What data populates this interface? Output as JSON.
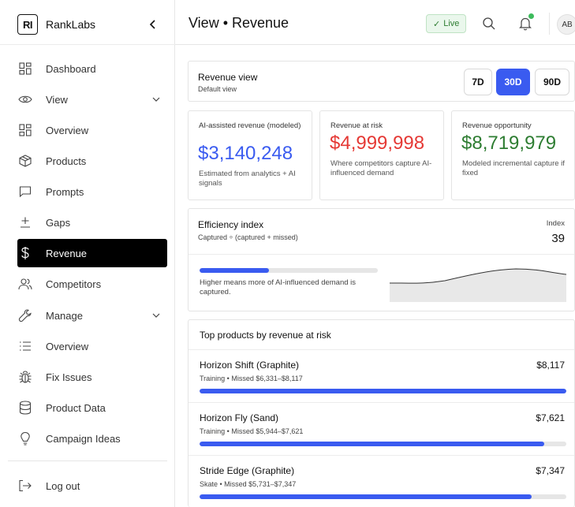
{
  "brand": {
    "mark": "RI",
    "name": "RankLabs"
  },
  "sidebar": {
    "top": [
      {
        "label": "Dashboard",
        "icon": "grid-icon"
      },
      {
        "label": "View",
        "icon": "eye-icon"
      }
    ],
    "view_items": [
      {
        "label": "Overview",
        "icon": "grid-icon"
      },
      {
        "label": "Products",
        "icon": "box-icon"
      },
      {
        "label": "Prompts",
        "icon": "message-icon"
      },
      {
        "label": "Gaps",
        "icon": "plus-minus-icon"
      },
      {
        "label": "Revenue",
        "icon": "dollar-icon"
      },
      {
        "label": "Competitors",
        "icon": "users-icon"
      }
    ],
    "manage": {
      "label": "Manage",
      "icon": "wrench-icon"
    },
    "manage_items": [
      {
        "label": "Overview",
        "icon": "list-icon"
      },
      {
        "label": "Fix Issues",
        "icon": "bug-icon"
      },
      {
        "label": "Product Data",
        "icon": "database-icon"
      },
      {
        "label": "Campaign Ideas",
        "icon": "lightbulb-icon"
      }
    ],
    "logout": {
      "label": "Log out",
      "icon": "logout-icon"
    },
    "active": "Revenue"
  },
  "header": {
    "title": "View • Revenue",
    "live_label": "Live",
    "avatar": "AB"
  },
  "revenue_view": {
    "title": "Revenue view",
    "subtitle": "Default view",
    "ranges": [
      "7D",
      "30D",
      "90D"
    ],
    "selected": "30D"
  },
  "metrics": [
    {
      "label": "AI-assisted revenue (modeled)",
      "value": "$3,140,248",
      "note": "Estimated from analytics + AI signals",
      "color": "#3a5bf0"
    },
    {
      "label": "Revenue at risk",
      "value": "$4,999,998",
      "note": "Where competitors capture AI-influenced demand",
      "color": "#e53935"
    },
    {
      "label": "Revenue opportunity",
      "value": "$8,719,979",
      "note": "Modeled incremental capture if fixed",
      "color": "#2e7d32"
    }
  ],
  "efficiency": {
    "title": "Efficiency index",
    "subtitle": "Captured ÷ (captured + missed)",
    "index_label": "Index",
    "index_value": "39",
    "progress": 0.39,
    "note": "Higher means more of AI-influenced demand is captured."
  },
  "top_products": {
    "title": "Top products by revenue at risk",
    "items": [
      {
        "name": "Horizon Shift (Graphite)",
        "amount": "$8,117",
        "meta": "Training • Missed $6,331–$8,117",
        "progress": 1.0
      },
      {
        "name": "Horizon Fly (Sand)",
        "amount": "$7,621",
        "meta": "Training • Missed $5,944–$7,621",
        "progress": 0.94
      },
      {
        "name": "Stride Edge (Graphite)",
        "amount": "$7,347",
        "meta": "Skate • Missed $5,731–$7,347",
        "progress": 0.905
      }
    ]
  }
}
